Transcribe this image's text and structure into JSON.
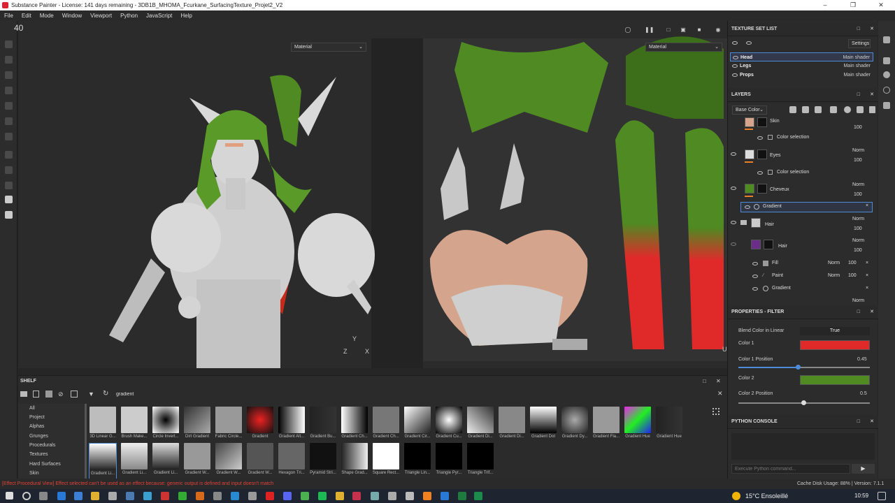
{
  "window": {
    "title": "Substance Painter - License: 141 days remaining - 3DB1B_MHOMA_Fcurkane_SurfacingTexture_Projet2_V2"
  },
  "menu": [
    "File",
    "Edit",
    "Mode",
    "Window",
    "Viewport",
    "Python",
    "JavaScript",
    "Help"
  ],
  "viewport": {
    "fps": "40",
    "left_dropdown": "Material",
    "right_dropdown": "Material",
    "axis_y": "Y",
    "axis_z": "Z",
    "axis_x": "X",
    "axis_u": "U"
  },
  "texture_set_list": {
    "title": "TEXTURE SET LIST",
    "settings": "Settings",
    "items": [
      {
        "name": "Head",
        "shader": "Main shader"
      },
      {
        "name": "Legs",
        "shader": "Main shader"
      },
      {
        "name": "Props",
        "shader": "Main shader"
      }
    ]
  },
  "layers": {
    "title": "LAYERS",
    "channel": "Base Color",
    "rows": [
      {
        "name": "Skin",
        "opacity": "100"
      },
      {
        "name": "Color selection"
      },
      {
        "name": "Eyes",
        "blend": "Norm",
        "opacity": "100"
      },
      {
        "name": "Color selection"
      },
      {
        "name": "Cheveux",
        "blend": "Norm",
        "opacity": "100"
      },
      {
        "name": "Gradient"
      },
      {
        "name": "Hair",
        "blend": "Norm",
        "opacity": "100"
      },
      {
        "name": "Hair",
        "blend": "Norm",
        "opacity": "100"
      },
      {
        "name": "Fill",
        "blend": "Norm",
        "opacity": "100"
      },
      {
        "name": "Paint",
        "blend": "Norm",
        "opacity": "100"
      },
      {
        "name": "Gradient"
      },
      {
        "name": "",
        "blend": "Norm"
      }
    ]
  },
  "properties": {
    "title": "PROPERTIES - FILTER",
    "blend_label": "Blend Color in Linear",
    "blend_value": "True",
    "color1_label": "Color 1",
    "color1": "#e02a2a",
    "color1pos_label": "Color 1 Position",
    "color1pos_value": "0.45",
    "color2_label": "Color 2",
    "color2": "#4f8a22",
    "color2pos_label": "Color 2 Position",
    "color2pos_value": "0.5"
  },
  "python_console": {
    "title": "PYTHON CONSOLE",
    "placeholder": "Execute Python command..."
  },
  "shelf": {
    "title": "SHELF",
    "search": "gradient",
    "categories": [
      "All",
      "Project",
      "Alphas",
      "Grunges",
      "Procedurals",
      "Textures",
      "Hard Surfaces",
      "Skin"
    ],
    "row1": [
      "3D Linear G...",
      "Brush Make...",
      "Circle Invert...",
      "Dirt Gradient",
      "Fabric Circle...",
      "Gradient",
      "Gradient Alt...",
      "Gradient Bu...",
      "Gradient Ch...",
      "Gradient Ch...",
      "Gradient Cir...",
      "Gradient Cu...",
      "Gradient Di...",
      "Gradient Di...",
      "Gradient Dot",
      "Gradient Dy...",
      "Gradient Fla...",
      "Gradient Hue",
      "Gradient Hue"
    ],
    "row2": [
      "Gradient Li...",
      "Gradient Li...",
      "Gradient Li...",
      "Gradient W...",
      "Gradient W...",
      "Gradient W...",
      "Hexagon Tri...",
      "Pyramid Stri...",
      "Shape Grad...",
      "Square Rect...",
      "Triangle Lin...",
      "Triangle Pyr...",
      "Triangle Trif..."
    ]
  },
  "status": {
    "error": "[Effect Procedural View] Effect selected can't be used as an effect because: generic output is defined and input doesn't match",
    "disk": "Cache Disk Usage:   88% | Version: 7.1.1"
  },
  "taskbar": {
    "weather": "15°C  Ensoleillé",
    "time": "10:59"
  }
}
